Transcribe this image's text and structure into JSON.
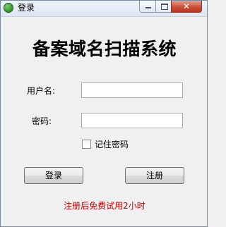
{
  "window": {
    "title": "登录"
  },
  "headline": "备案域名扫描系统",
  "form": {
    "username_label": "用户名:",
    "username_value": "",
    "password_label": "密码:",
    "password_value": "",
    "remember_label": "记住密码",
    "remember_checked": false
  },
  "buttons": {
    "login": "登录",
    "register": "注册"
  },
  "notice": "注册后免费试用2小时",
  "colors": {
    "notice": "#c00000",
    "close_button": "#c9503a"
  },
  "icons": {
    "app": "app-icon",
    "minimize": "minimize-icon",
    "maximize": "maximize-icon",
    "close": "close-icon"
  }
}
